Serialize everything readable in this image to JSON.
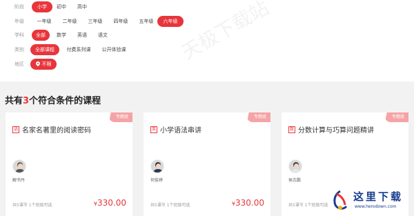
{
  "filters": {
    "stage": {
      "label": "阶段",
      "options": [
        "小学",
        "初中",
        "高中"
      ],
      "active": 0
    },
    "grade": {
      "label": "年级",
      "options": [
        "一年级",
        "二年级",
        "三年级",
        "四年级",
        "五年级",
        "六年级"
      ],
      "active": 5
    },
    "subject": {
      "label": "学科",
      "options": [
        "全部",
        "数学",
        "英语",
        "语文"
      ],
      "active": 0
    },
    "category": {
      "label": "类别",
      "options": [
        "全部课程",
        "付费系列课",
        "公开体验课"
      ],
      "active": 0
    },
    "region": {
      "label": "地区",
      "value": "不限",
      "icon": "location-pin-icon"
    }
  },
  "watermark": "天极下载站",
  "results": {
    "prefix": "共有",
    "count": "3",
    "suffix": "个符合条件的课程"
  },
  "courses": [
    {
      "badge": "专题班",
      "subject_icon": "语",
      "title": "名家名著里的阅读密码",
      "teacher": "解书丹",
      "meta": "共5课节  1个班级可选",
      "currency": "¥",
      "price": "330.00"
    },
    {
      "badge": "专题班",
      "subject_icon": "英",
      "title": "小学语法串讲",
      "teacher": "何俊婷",
      "meta": "共5课节  1个班级可选",
      "currency": "¥",
      "price": "330.00"
    },
    {
      "badge": "专题班",
      "subject_icon": "数",
      "title": "分数计算与巧算问题精讲",
      "teacher": "侯志鹏",
      "meta": "共5课节  1个班级可选",
      "currency": "¥",
      "price": ""
    }
  ],
  "logo": {
    "text": "这里下载",
    "url": "www.herodown.com"
  },
  "colors": {
    "accent": "#e8353b",
    "badge": "#f5a3a6",
    "logo": "#173c8e"
  }
}
